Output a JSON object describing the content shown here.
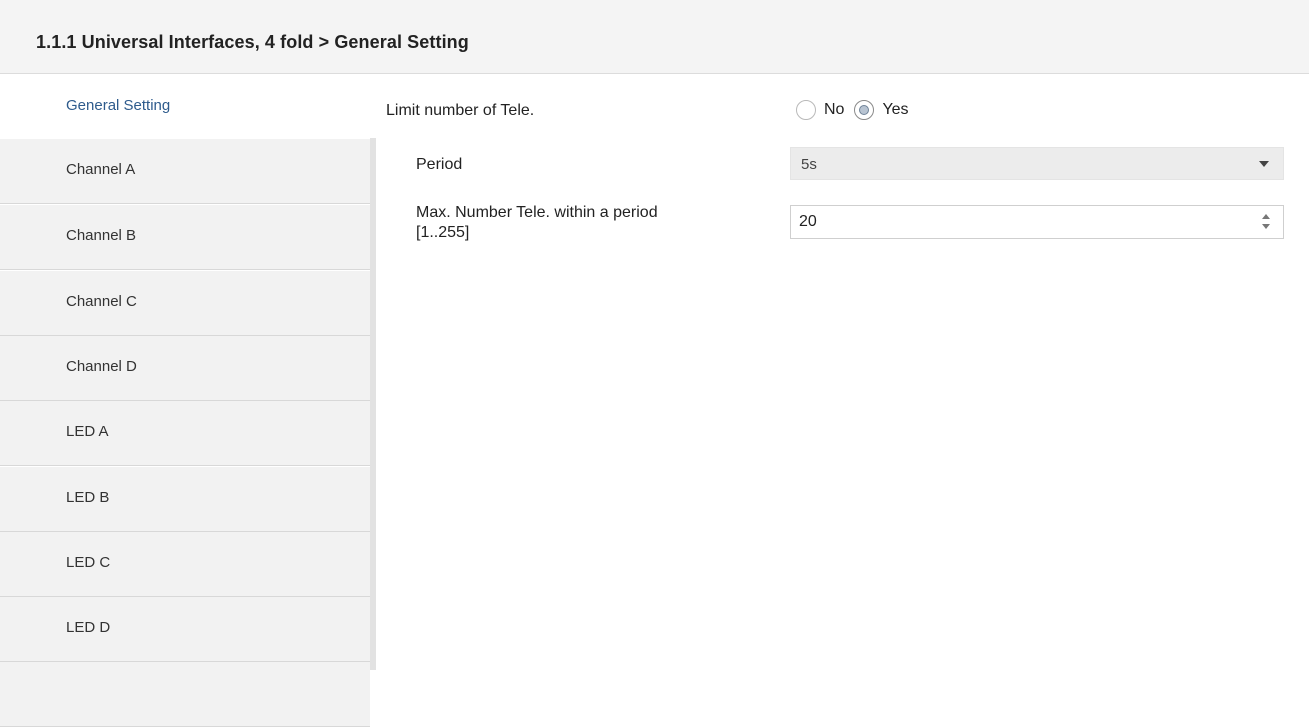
{
  "header": {
    "title": "1.1.1 Universal Interfaces, 4 fold > General Setting"
  },
  "sidebar": {
    "items": [
      {
        "label": "General Setting",
        "active": true
      },
      {
        "label": "Channel A"
      },
      {
        "label": "Channel B"
      },
      {
        "label": "Channel C"
      },
      {
        "label": "Channel D"
      },
      {
        "label": "LED A"
      },
      {
        "label": "LED B"
      },
      {
        "label": "LED C"
      },
      {
        "label": "LED D"
      }
    ]
  },
  "main": {
    "limit_tele": {
      "label": "Limit number of Tele.",
      "options": [
        "No",
        "Yes"
      ],
      "selected": "Yes"
    },
    "period": {
      "label": "Period",
      "value": "5s"
    },
    "max_tele": {
      "label_line1": "Max. Number Tele. within a period",
      "label_line2": "[1..255]",
      "value": "20"
    }
  },
  "colors": {
    "active_nav_text": "#2e5b8c",
    "header_bg": "#f4f4f4",
    "nav_bg": "#f2f2f2"
  }
}
